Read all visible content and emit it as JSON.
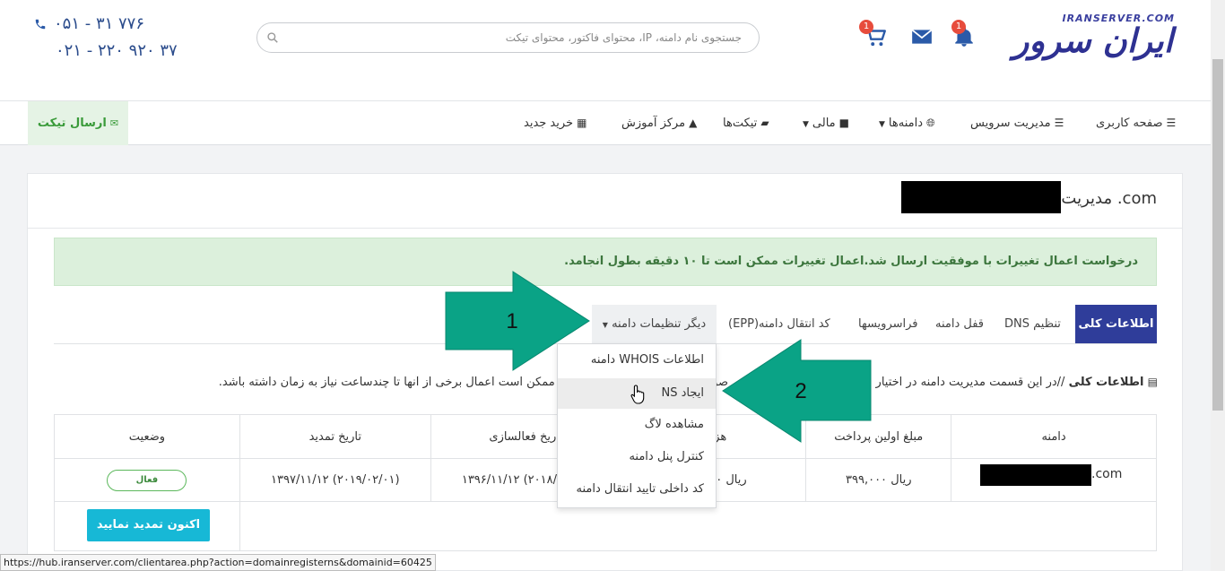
{
  "header": {
    "logo_small": "IRANSERVER.COM",
    "logo_main": "ایران سرور",
    "notifications_count": "1",
    "cart_count": "1",
    "search_placeholder": "جستجوی نام دامنه، IP، محتوای فاکتور، محتوای تیکت",
    "phone1": "۰۵۱ - ۳۱ ۷۷۶",
    "phone2": "۰۲۱ - ۲۲۰ ۹۲۰ ۳۷"
  },
  "nav": {
    "dashboard": "صفحه کاربری",
    "services": "مدیریت سرویس",
    "domains": "دامنه‌ها",
    "finance": "مالی",
    "tickets": "تیکت‌ها",
    "learning": "مرکز آموزش",
    "new_purchase": "خرید جدید",
    "send_ticket": "ارسال تیکت"
  },
  "panel": {
    "title": "مدیریت .com",
    "alert": "درخواست اعمال تغییرات با موفقیت ارسال شد.اعمال تغییرات ممکن است تا ۱۰ دقیقه بطول انجامد.",
    "tabs": {
      "general": "اطلاعات کلی",
      "dns": "تنظیم DNS",
      "lock": "قفل دامنه",
      "whois_services": "فراسرویسها",
      "epp": "کد انتقال دامنه(EPP)",
      "other": "دیگر تنظیمات دامنه"
    },
    "info_label": "اطلاعات کلی",
    "info_text": "//در این قسمت مدیریت دامنه در اختیار شما قرار داده شده است. در صورت نیاز تنظیمات را تغییر دهید و ممکن است اعمال برخی از آنها تا چندساعت نیاز به زمان داشته باشد.",
    "table": {
      "headers": [
        "دامنه",
        "مبلغ اولین پرداخت",
        "هزینه",
        "تاریخ فعالسازی",
        "تاریخ تمدید",
        "وضعیت"
      ],
      "row": {
        "domain_suffix": ".com",
        "first_payment": "۳۹۹,۰۰۰ ریال",
        "cost": "۳۹۹,۰۰۰ ریال",
        "activation": "۱۳۹۶/۱۱/۱۲ (۲۰۱۸/۰۲/۰۱)",
        "renewal": "۱۳۹۷/۱۱/۱۲ (۲۰۱۹/۰۲/۰۱)",
        "status": "فعال"
      },
      "renew_button": "اکنون تمدید نمایید"
    }
  },
  "dropdown": {
    "items": [
      "اطلاعات WHOIS دامنه",
      "ایجاد NS",
      "مشاهده لاگ",
      "کنترل پنل دامنه",
      "کد داخلی تایید انتقال دامنه"
    ]
  },
  "annotations": {
    "arrow1": "1",
    "arrow2": "2",
    "color": "#0aa386"
  },
  "statusbar": {
    "url": "https://hub.iranserver.com/clientarea.php?action=domainregisterns&domainid=60425"
  }
}
